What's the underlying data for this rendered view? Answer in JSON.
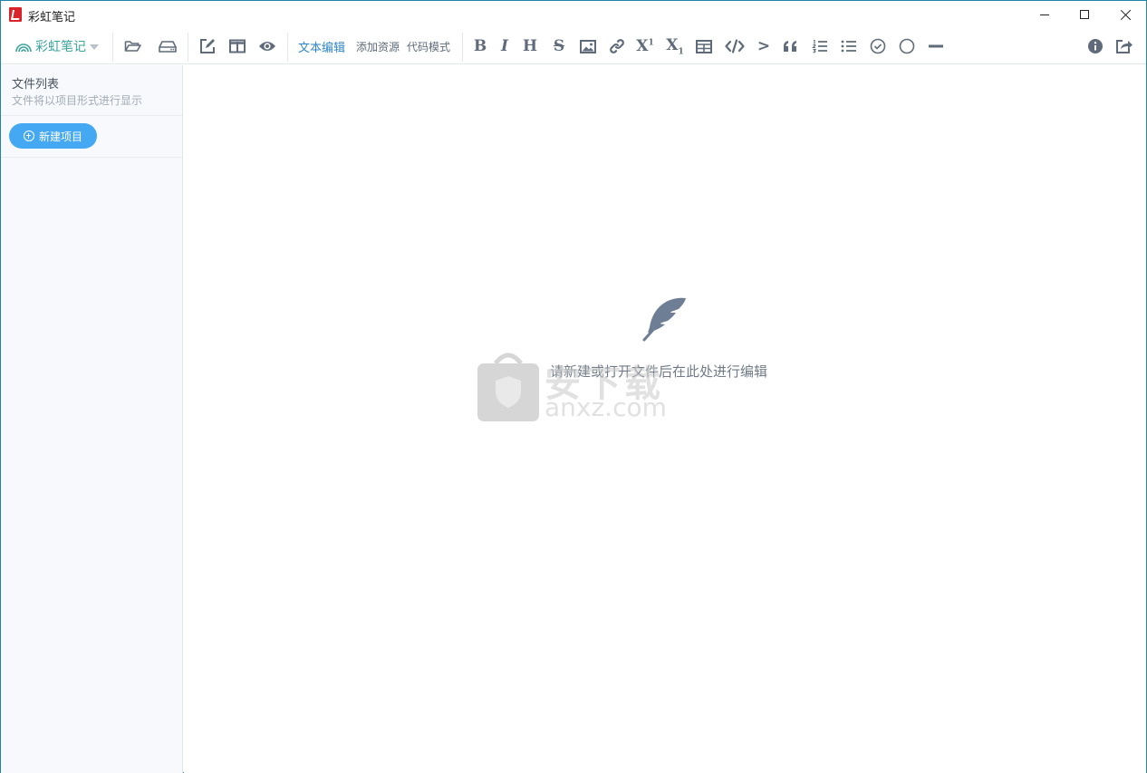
{
  "window": {
    "title": "彩虹笔记",
    "controls": {
      "minimize": "minimize-icon",
      "maximize": "maximize-icon",
      "close": "close-icon"
    }
  },
  "toolbar": {
    "brand_label": "彩虹笔记",
    "file_icons": [
      "folder-open-icon",
      "hard-drive-icon"
    ],
    "view_icons": [
      "edit-icon",
      "split-view-icon",
      "preview-eye-icon"
    ],
    "modes": [
      {
        "label": "文本编辑",
        "active": true
      },
      {
        "label": "添加资源",
        "active": false
      },
      {
        "label": "代码模式",
        "active": false
      }
    ],
    "format_glyphs": {
      "bold": "B",
      "italic": "I",
      "heading": "H",
      "strike": "S",
      "superscript": "X",
      "sup_mark": "1",
      "subscript": "X",
      "sub_mark": "1",
      "blockquote_arrow": ">"
    },
    "format_icons": [
      "bold-icon",
      "italic-icon",
      "heading-icon",
      "strikethrough-icon",
      "image-icon",
      "link-icon",
      "superscript-icon",
      "subscript-icon",
      "table-icon",
      "code-icon",
      "arrow-icon",
      "quote-icon",
      "ordered-list-icon",
      "unordered-list-icon",
      "check-circle-icon",
      "circle-icon",
      "horizontal-rule-icon"
    ],
    "right_icons": [
      "info-icon",
      "share-icon"
    ],
    "accent_color": "#2f86c6"
  },
  "sidebar": {
    "title": "文件列表",
    "subtitle": "文件将以项目形式进行显示",
    "new_project_label": "新建项目",
    "button_color": "#45a8f3"
  },
  "editor": {
    "empty_hint": "请新建或打开文件后在此处进行编辑",
    "empty_icon": "feather-icon"
  },
  "watermark": {
    "text_cn": "安下载",
    "text_en": "anxz.com"
  }
}
